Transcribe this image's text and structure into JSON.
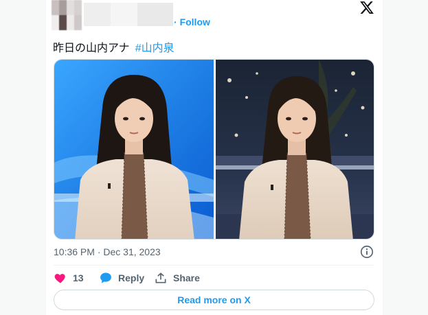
{
  "header": {
    "follow_label": "Follow",
    "logo_icon": "x-logo-icon"
  },
  "tweet": {
    "text": "昨日の山内アナ",
    "hashtag": "#山内泉"
  },
  "media": {
    "images": [
      {
        "name": "photo-studio-blue-background"
      },
      {
        "name": "photo-studio-night-city-background"
      }
    ]
  },
  "meta": {
    "timestamp": "10:36 PM · Dec 31, 2023"
  },
  "actions": {
    "like_count": "13",
    "reply_label": "Reply",
    "share_label": "Share"
  },
  "footer": {
    "read_more_label": "Read more on X"
  },
  "colors": {
    "accent": "#1d9bf0",
    "like": "#f91880",
    "text": "#0f1419",
    "muted": "#536471"
  }
}
